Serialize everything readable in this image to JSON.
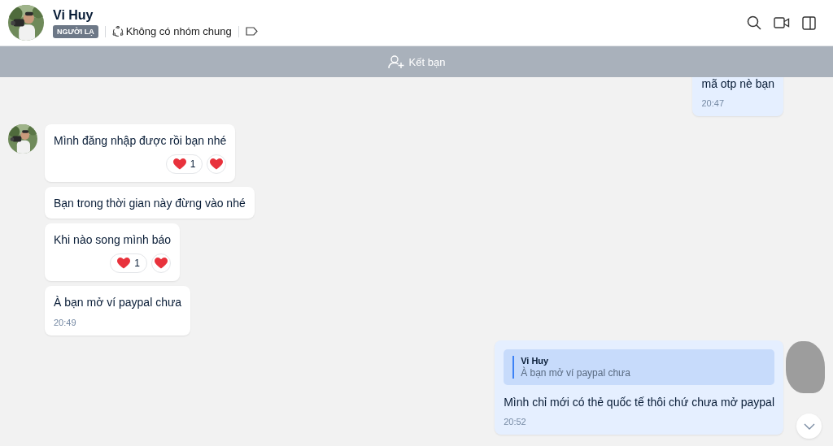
{
  "header": {
    "name": "Vi Huy",
    "badge": "NGƯỜI LẠ",
    "common_groups": "Không có nhóm chung"
  },
  "friend_bar": {
    "label": "Kết bạn"
  },
  "messages": [
    {
      "kind": "outgoing",
      "text": "mã otp nè bạn",
      "time": "20:47"
    },
    {
      "kind": "incoming",
      "show_avatar": true,
      "text": "Mình đăng nhập được rồi bạn nhé",
      "reaction_count": "1"
    },
    {
      "kind": "incoming",
      "show_avatar": false,
      "text": "Bạn trong thời gian này đừng vào nhé"
    },
    {
      "kind": "incoming",
      "show_avatar": false,
      "text": "Khi nào song mình báo",
      "reaction_count": "1"
    },
    {
      "kind": "incoming",
      "show_avatar": false,
      "text": "À bạn mở ví paypal chưa",
      "time": "20:49"
    },
    {
      "kind": "outgoing",
      "quote": {
        "author": "Vi Huy",
        "text": "À bạn mở ví paypal chưa"
      },
      "text": "Mình chỉ mới có thẻ quốc tế thôi chứ chưa mở paypal",
      "time": "20:52"
    }
  ]
}
